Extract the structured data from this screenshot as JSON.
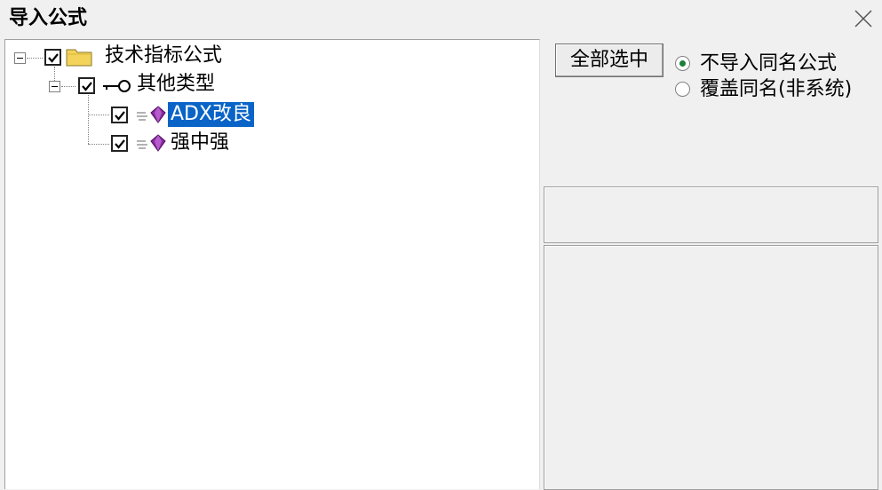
{
  "window": {
    "title": "导入公式"
  },
  "tree": {
    "root": {
      "label": "技术指标公式",
      "checked": true,
      "expanded": true,
      "icon": "folder-icon"
    },
    "group": {
      "label": "其他类型",
      "checked": true,
      "expanded": true,
      "icon": "key-icon"
    },
    "items": [
      {
        "label": "ADX改良",
        "checked": true,
        "selected": true,
        "icon": "formula-gem-icon"
      },
      {
        "label": "强中强",
        "checked": true,
        "selected": false,
        "icon": "formula-gem-icon"
      }
    ]
  },
  "actions": {
    "select_all_label": "全部选中"
  },
  "options": {
    "radios": [
      {
        "label": "不导入同名公式",
        "checked": true
      },
      {
        "label": "覆盖同名(非系统)",
        "checked": false
      }
    ]
  },
  "colors": {
    "selection": "#0a64c8",
    "gem": "#8a2aa0",
    "radio_dot": "#1b7f3a",
    "folder": "#f3d35a"
  }
}
